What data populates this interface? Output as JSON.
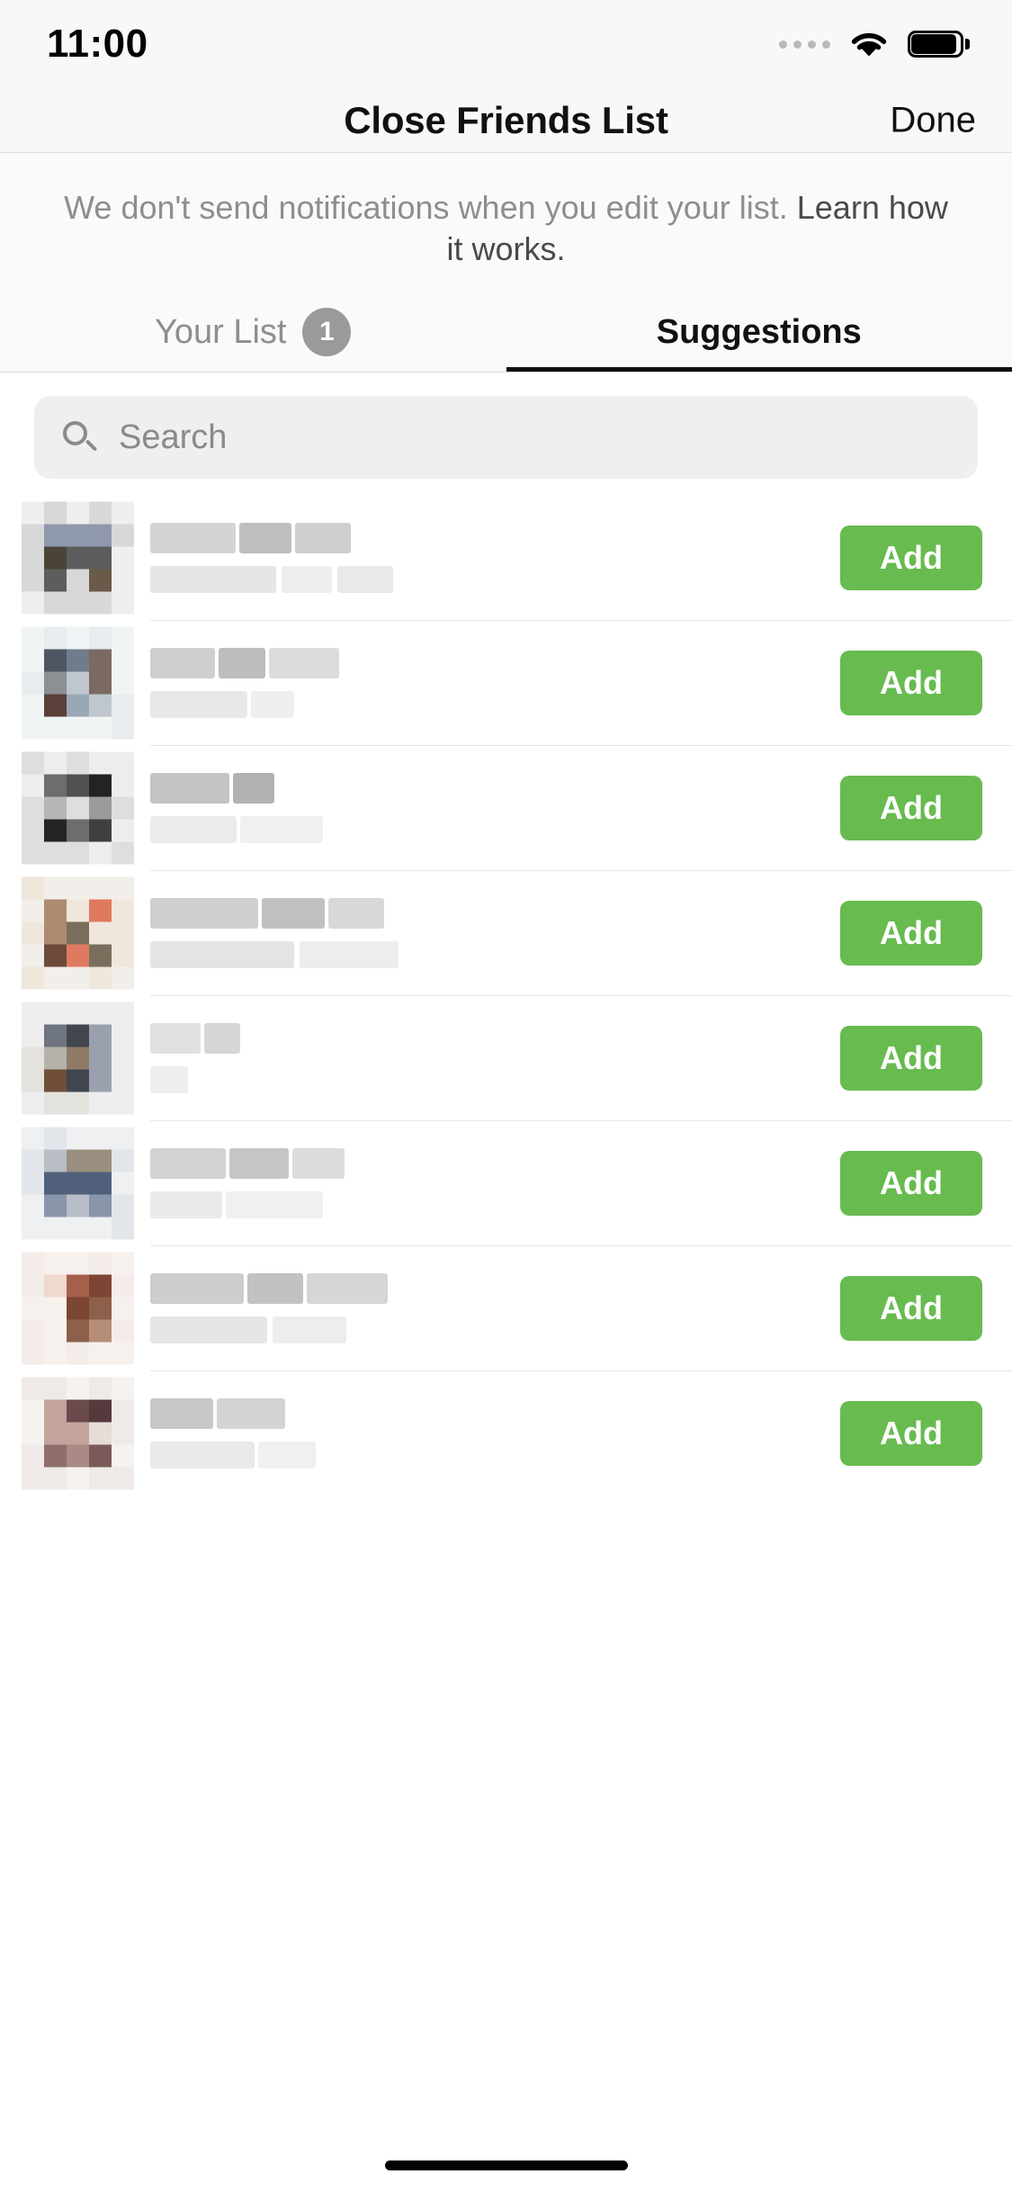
{
  "status_bar": {
    "time": "11:00",
    "cellular_icon": "signal-dots-icon",
    "wifi_icon": "wifi-icon",
    "battery_icon": "battery-full-icon"
  },
  "nav": {
    "title": "Close Friends List",
    "done_label": "Done"
  },
  "notice": {
    "text": "We don't send notifications when you edit your list. ",
    "link_text": "Learn how it works."
  },
  "tabs": [
    {
      "label": "Your List",
      "badge": "1",
      "active": false
    },
    {
      "label": "Suggestions",
      "badge": "",
      "active": true
    }
  ],
  "search": {
    "placeholder": "Search",
    "value": "",
    "icon": "search-icon"
  },
  "colors": {
    "add_button": "#68bb4f",
    "tab_active": "#111111",
    "tab_inactive": "#8e8e8e",
    "badge": "#9a9a9a",
    "search_field": "#efefef"
  },
  "suggestions": [
    {
      "add_label": "Add",
      "name_redacted": true,
      "username_redacted": true
    },
    {
      "add_label": "Add",
      "name_redacted": true,
      "username_redacted": true
    },
    {
      "add_label": "Add",
      "name_redacted": true,
      "username_redacted": true
    },
    {
      "add_label": "Add",
      "name_redacted": true,
      "username_redacted": true
    },
    {
      "add_label": "Add",
      "name_redacted": true,
      "username_redacted": true
    },
    {
      "add_label": "Add",
      "name_redacted": true,
      "username_redacted": true
    },
    {
      "add_label": "Add",
      "name_redacted": true,
      "username_redacted": true
    },
    {
      "add_label": "Add",
      "name_redacted": true,
      "username_redacted": true
    }
  ]
}
